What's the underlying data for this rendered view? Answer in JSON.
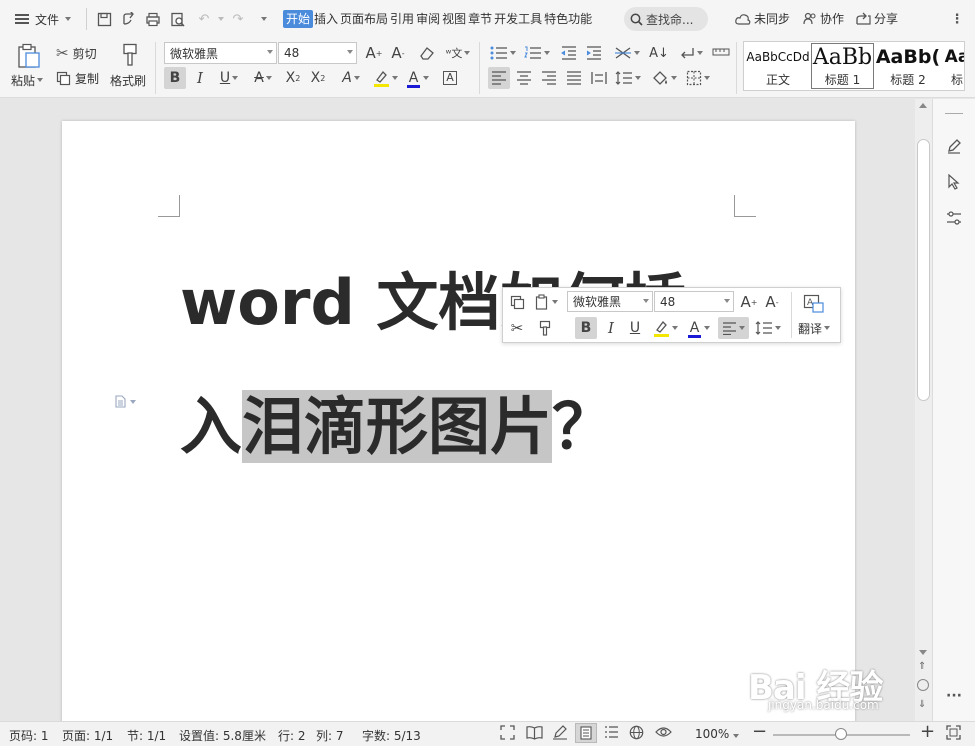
{
  "menubar": {
    "file_label": "文件",
    "tabs": [
      "开始",
      "插入",
      "页面布局",
      "引用",
      "审阅",
      "视图",
      "章节",
      "开发工具",
      "特色功能"
    ],
    "active_tab": "开始",
    "search_placeholder": "查找命...",
    "sync_label": "未同步",
    "collab_label": "协作",
    "share_label": "分享"
  },
  "ribbon": {
    "paste_label": "粘贴",
    "cut_label": "剪切",
    "copy_label": "复制",
    "format_painter_label": "格式刷",
    "font_name": "微软雅黑",
    "font_size": "48",
    "styles": [
      {
        "preview": "AaBbCcDd",
        "name": "正文"
      },
      {
        "preview": "AaBb",
        "name": "标题 1"
      },
      {
        "preview": "AaBb(",
        "name": "标题 2"
      },
      {
        "preview": "Aa",
        "name": "标"
      }
    ],
    "selected_style": "标题 1"
  },
  "document": {
    "heading_line1": "word 文档如何插",
    "heading_line2_pre": "入",
    "heading_line2_sel": "泪滴形图片",
    "heading_line2_post": "？"
  },
  "mini_toolbar": {
    "font_name": "微软雅黑",
    "font_size": "48",
    "translate_label": "翻译"
  },
  "statusbar": {
    "page_num": "页码: 1",
    "pages": "页面: 1/1",
    "section": "节: 1/1",
    "setting": "设置值: 5.8厘米",
    "row": "行: 2",
    "col": "列: 7",
    "word_count": "字数: 5/13",
    "zoom": "100%",
    "zoom_level": 1.0
  },
  "watermark": {
    "brand": "Bai 经验",
    "url": "jingyan.baidu.com"
  },
  "colors": {
    "accent": "#4a8bdc",
    "selection": "#c6c6c6",
    "font_color_bar": "#1a1ad6",
    "highlight_bar": "#f3e600",
    "text_dark": "#2b2b2b"
  }
}
